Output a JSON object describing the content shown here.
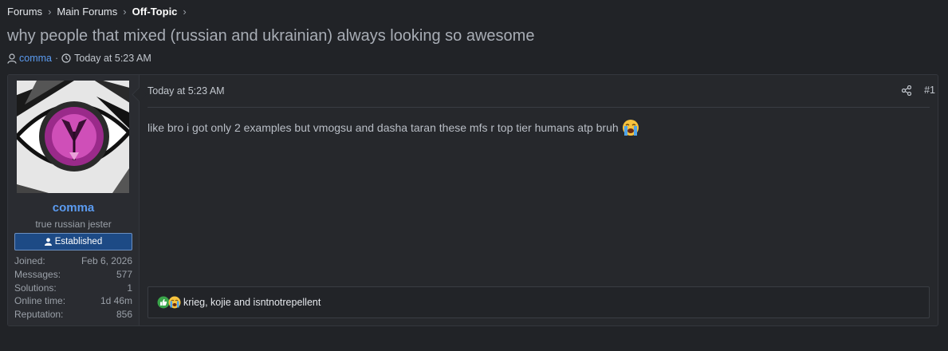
{
  "breadcrumb": {
    "items": [
      "Forums",
      "Main Forums",
      "Off-Topic"
    ],
    "sep": "›"
  },
  "thread": {
    "title": "why people that mixed (russian and ukrainian) always looking so awesome",
    "author": "comma",
    "sep": "·",
    "date": "Today at 5:23 AM"
  },
  "user": {
    "name": "comma",
    "title": "true russian jester",
    "banner": "Established",
    "stats": [
      {
        "label": "Joined:",
        "value": "Feb 6, 2026"
      },
      {
        "label": "Messages:",
        "value": "577"
      },
      {
        "label": "Solutions:",
        "value": "1"
      },
      {
        "label": "Online time:",
        "value": "1d 46m"
      },
      {
        "label": "Reputation:",
        "value": "856"
      }
    ]
  },
  "post": {
    "date": "Today at 5:23 AM",
    "number": "#1",
    "body": "like bro i got only 2 examples but vmogsu and dasha taran these mfs r top tier humans atp bruh",
    "body_emoji": "loudly-crying-face"
  },
  "reactions": {
    "icons": [
      "thumbs-up-icon",
      "crying-face-icon"
    ],
    "text": "krieg, kojie and isntnotrepellent"
  },
  "colors": {
    "background": "#212327",
    "accent": "#5b9bf0",
    "banner": "#1d4a85"
  }
}
